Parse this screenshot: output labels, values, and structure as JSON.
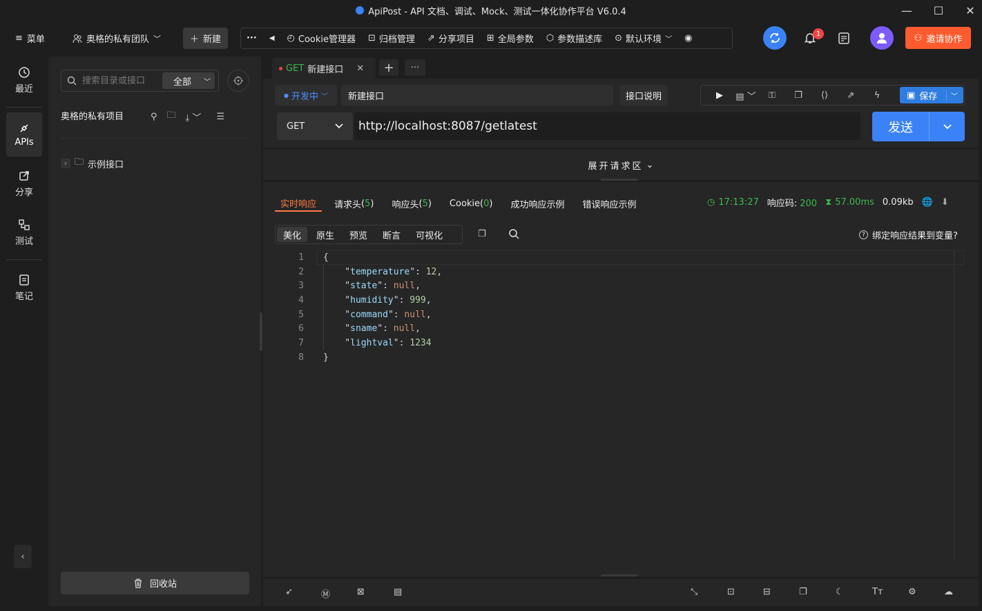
{
  "window": {
    "title": "ApiPost - API 文档、调试、Mock、测试一体化协作平台 V6.0.4"
  },
  "topbar": {
    "menu_label": "菜单",
    "team_label": "奥格的私有团队",
    "new_label": "新建",
    "tools": [
      {
        "label": "Cookie管理器",
        "icon": "cookie-icon"
      },
      {
        "label": "归档管理",
        "icon": "archive-icon"
      },
      {
        "label": "分享项目",
        "icon": "share-icon"
      },
      {
        "label": "全局参数",
        "icon": "params-icon"
      },
      {
        "label": "参数描述库",
        "icon": "cube-icon"
      },
      {
        "label": "默认环境",
        "icon": "env-icon"
      }
    ],
    "notification_count": "1",
    "invite_label": "邀请协作"
  },
  "leftnav": {
    "items": [
      {
        "label": "最近",
        "icon": "clock-icon"
      },
      {
        "label": "APIs",
        "icon": "apis-icon"
      },
      {
        "label": "分享",
        "icon": "share-icon"
      },
      {
        "label": "测试",
        "icon": "test-icon"
      },
      {
        "label": "笔记",
        "icon": "note-icon"
      }
    ]
  },
  "sidebar": {
    "search_placeholder": "搜索目录或接口",
    "scope": "全部",
    "project_title": "奥格的私有项目",
    "tree": [
      {
        "label": "示例接口"
      }
    ],
    "recycle_label": "回收站"
  },
  "tabs": [
    {
      "method": "GET",
      "name": "新建接口"
    }
  ],
  "request": {
    "status": "开发中",
    "name": "新建接口",
    "desc_label": "接口说明",
    "save_label": "保存",
    "method": "GET",
    "url": "http://localhost:8087/getlatest",
    "send_label": "发送",
    "expand_label": "展开请求区"
  },
  "response": {
    "tabs": {
      "realtime": "实时响应",
      "req_headers": "请求头",
      "req_headers_count": "5",
      "resp_headers": "响应头",
      "resp_headers_count": "5",
      "cookie": "Cookie",
      "cookie_count": "0",
      "success_example": "成功响应示例",
      "error_example": "错误响应示例"
    },
    "time": "17:13:27",
    "code_label": "响应码:",
    "code": "200",
    "duration": "57.00ms",
    "size": "0.09kb",
    "views": [
      "美化",
      "原生",
      "预览",
      "断言",
      "可视化"
    ],
    "bind_label": "绑定响应结果到变量?",
    "body_lines": [
      {
        "n": "1",
        "k": "",
        "v": "{"
      },
      {
        "n": "2",
        "k": "temperature",
        "v": "12",
        "t": "num",
        "c": ","
      },
      {
        "n": "3",
        "k": "state",
        "v": "null",
        "t": "null",
        "c": ","
      },
      {
        "n": "4",
        "k": "humidity",
        "v": "999",
        "t": "num",
        "c": ","
      },
      {
        "n": "5",
        "k": "command",
        "v": "null",
        "t": "null",
        "c": ","
      },
      {
        "n": "6",
        "k": "sname",
        "v": "null",
        "t": "null",
        "c": ","
      },
      {
        "n": "7",
        "k": "lightval",
        "v": "1234",
        "t": "num",
        "c": ""
      },
      {
        "n": "8",
        "k": "",
        "v": "}"
      }
    ]
  }
}
